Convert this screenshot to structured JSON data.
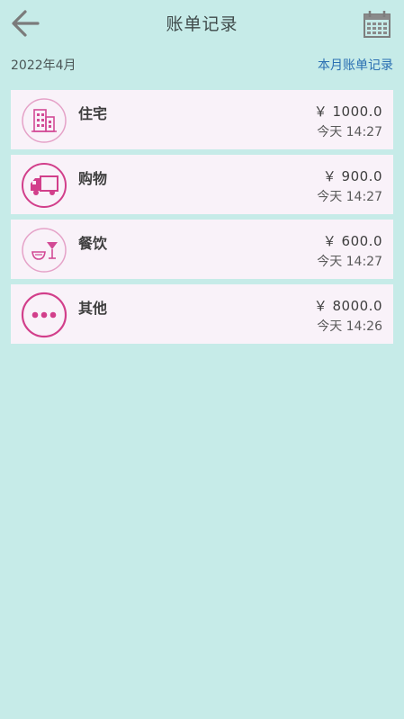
{
  "header": {
    "title": "账单记录",
    "back_icon": "arrow-left-icon",
    "calendar_icon": "calendar-icon"
  },
  "month": {
    "label": "2022年4月",
    "link": "本月账单记录"
  },
  "colors": {
    "background": "#c6ebe8",
    "card": "#f9f2f9",
    "accent": "#d23f8b",
    "link": "#2a6fb2"
  },
  "records": [
    {
      "name": "住宅",
      "icon": "building-icon",
      "amount": "￥ 1000.0",
      "time": "今天 14:27"
    },
    {
      "name": "购物",
      "icon": "delivery-truck-icon",
      "amount": "￥ 900.0",
      "time": "今天 14:27"
    },
    {
      "name": "餐饮",
      "icon": "food-drink-icon",
      "amount": "￥ 600.0",
      "time": "今天 14:27"
    },
    {
      "name": "其他",
      "icon": "more-icon",
      "amount": "￥ 8000.0",
      "time": "今天 14:26"
    }
  ]
}
